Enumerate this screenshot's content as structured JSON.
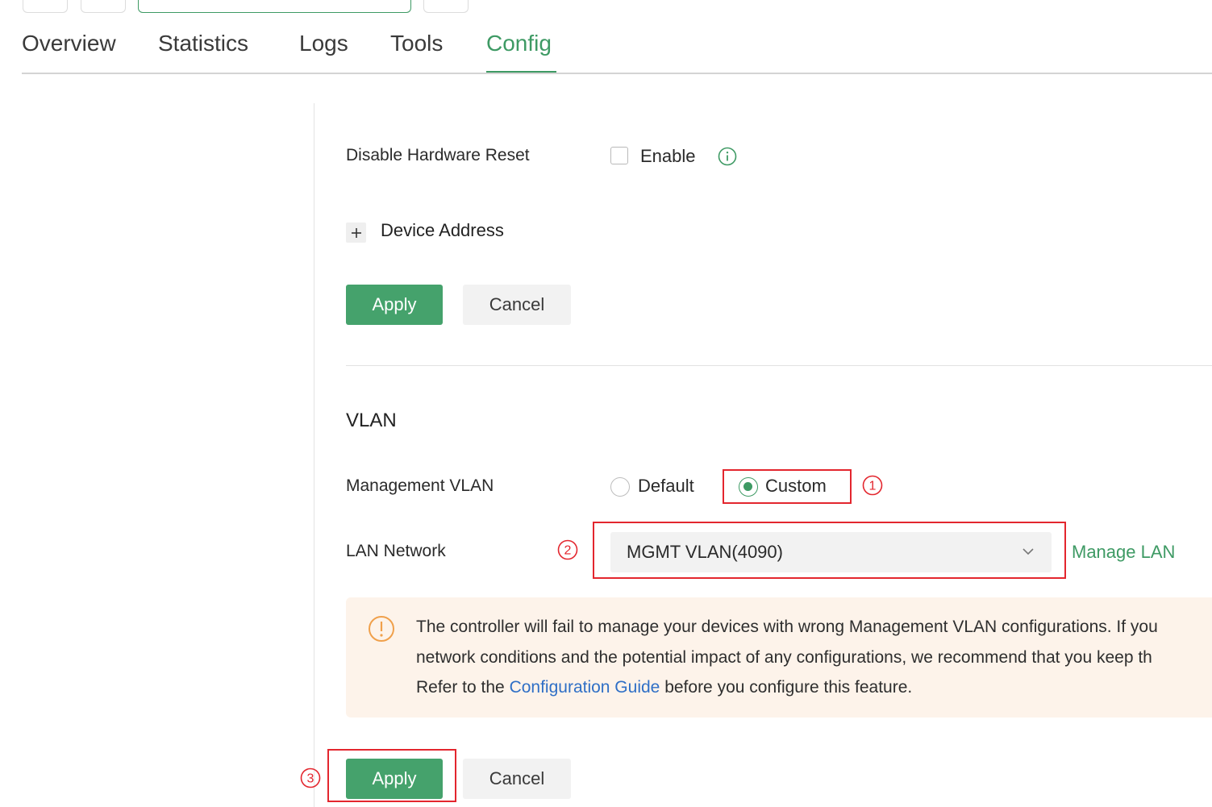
{
  "tabs": [
    {
      "label": "Overview",
      "active": false
    },
    {
      "label": "Statistics",
      "active": false
    },
    {
      "label": "Logs",
      "active": false
    },
    {
      "label": "Tools",
      "active": false
    },
    {
      "label": "Config",
      "active": true
    }
  ],
  "hardware_reset": {
    "label": "Disable Hardware Reset",
    "checkbox_label": "Enable",
    "checked": false,
    "info_icon": "info-icon"
  },
  "device_address": {
    "label": "Device Address",
    "expanded": false
  },
  "actions_top": {
    "apply_label": "Apply",
    "cancel_label": "Cancel"
  },
  "vlan": {
    "title": "VLAN",
    "management_vlan_label": "Management VLAN",
    "options": [
      {
        "label": "Default",
        "selected": false
      },
      {
        "label": "Custom",
        "selected": true
      }
    ],
    "lan_network_label": "LAN Network",
    "lan_network_value": "MGMT VLAN(4090)",
    "manage_lan_link": "Manage LAN"
  },
  "warning": {
    "line1": "The controller will fail to manage your devices with wrong Management VLAN configurations. If you",
    "line2": "network conditions and the potential impact of any configurations, we recommend that you keep th",
    "line3_prefix": "Refer to the ",
    "line3_link": "Configuration Guide",
    "line3_suffix": " before you configure this feature."
  },
  "actions_bottom": {
    "apply_label": "Apply",
    "cancel_label": "Cancel"
  },
  "callouts": {
    "one": "1",
    "two": "2",
    "three": "3"
  },
  "colors": {
    "accent": "#3e9a64",
    "button_primary": "#45a26c",
    "highlight": "#e3262e",
    "warning_bg": "#fdf3ea",
    "warning_icon": "#f0a04b",
    "link_blue": "#2f6fc6"
  }
}
